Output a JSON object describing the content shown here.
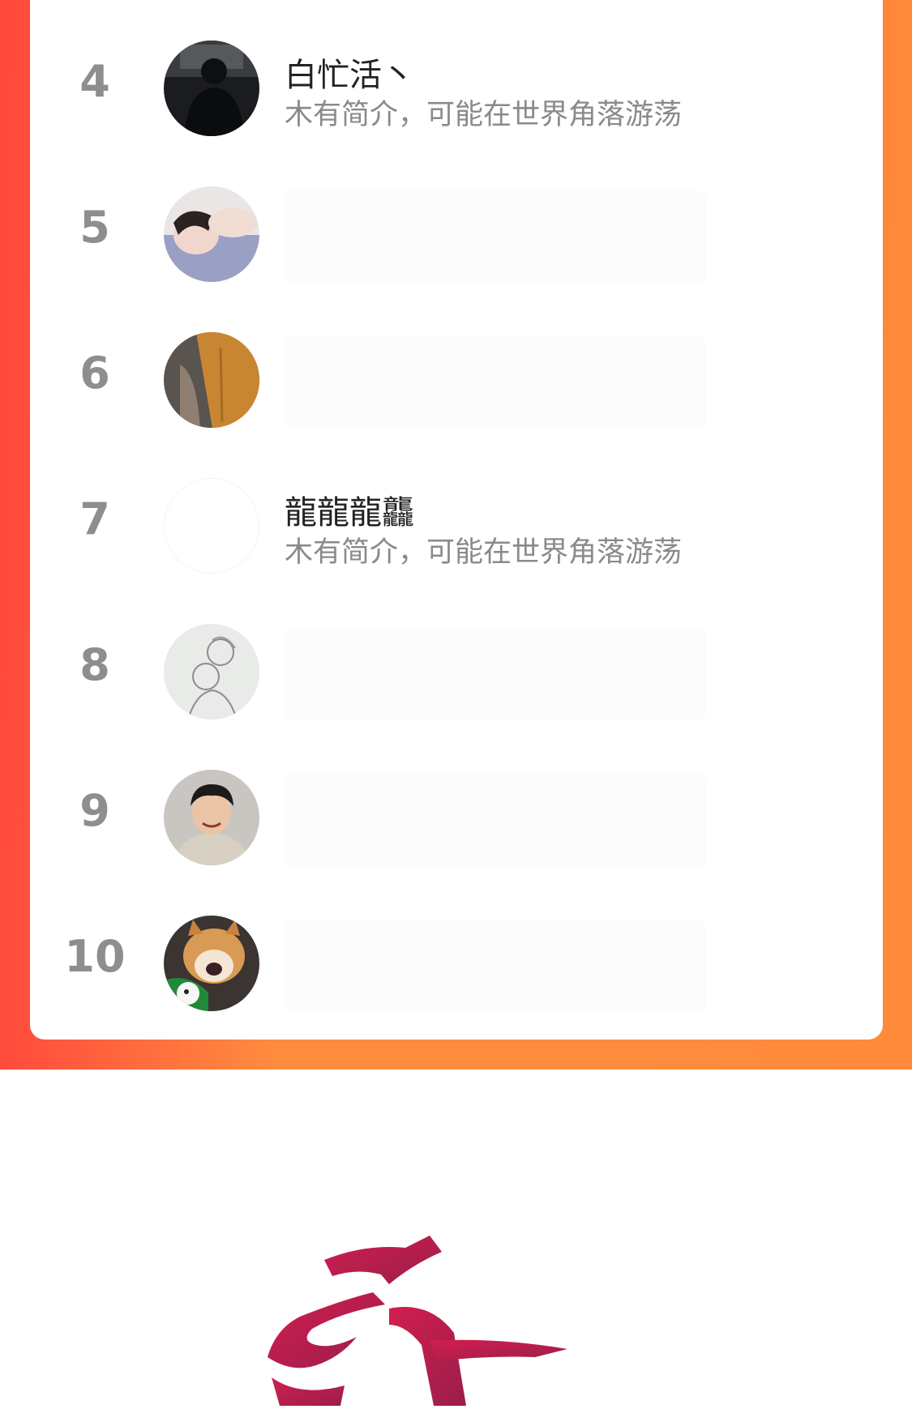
{
  "ranking": {
    "rows": [
      {
        "rank": "4",
        "name": "白忙活丶",
        "bio": "木有简介，可能在世界角落游荡",
        "avatar": "dark-silhouette-avatar"
      },
      {
        "rank": "5",
        "name": "",
        "bio": "",
        "avatar": "person-lying-avatar"
      },
      {
        "rank": "6",
        "name": "",
        "bio": "",
        "avatar": "orange-shirt-avatar"
      },
      {
        "rank": "7",
        "name": "龍龍龍龘",
        "bio": "木有简介，可能在世界角落游荡",
        "avatar": "blank-avatar"
      },
      {
        "rank": "8",
        "name": "",
        "bio": "",
        "avatar": "sketch-drawing-avatar"
      },
      {
        "rank": "9",
        "name": "",
        "bio": "",
        "avatar": "smiling-boy-avatar"
      },
      {
        "rank": "10",
        "name": "",
        "bio": "",
        "avatar": "shiba-dog-avatar"
      }
    ]
  },
  "colors": {
    "banner_left": "#ff4a3c",
    "banner_right": "#ff8a3a",
    "rank_text": "#8e8e8e",
    "bio_text": "#8a8a8a",
    "logo_red": "#c8234a"
  },
  "footer": {
    "logo": "calligraphy-logo-icon"
  }
}
